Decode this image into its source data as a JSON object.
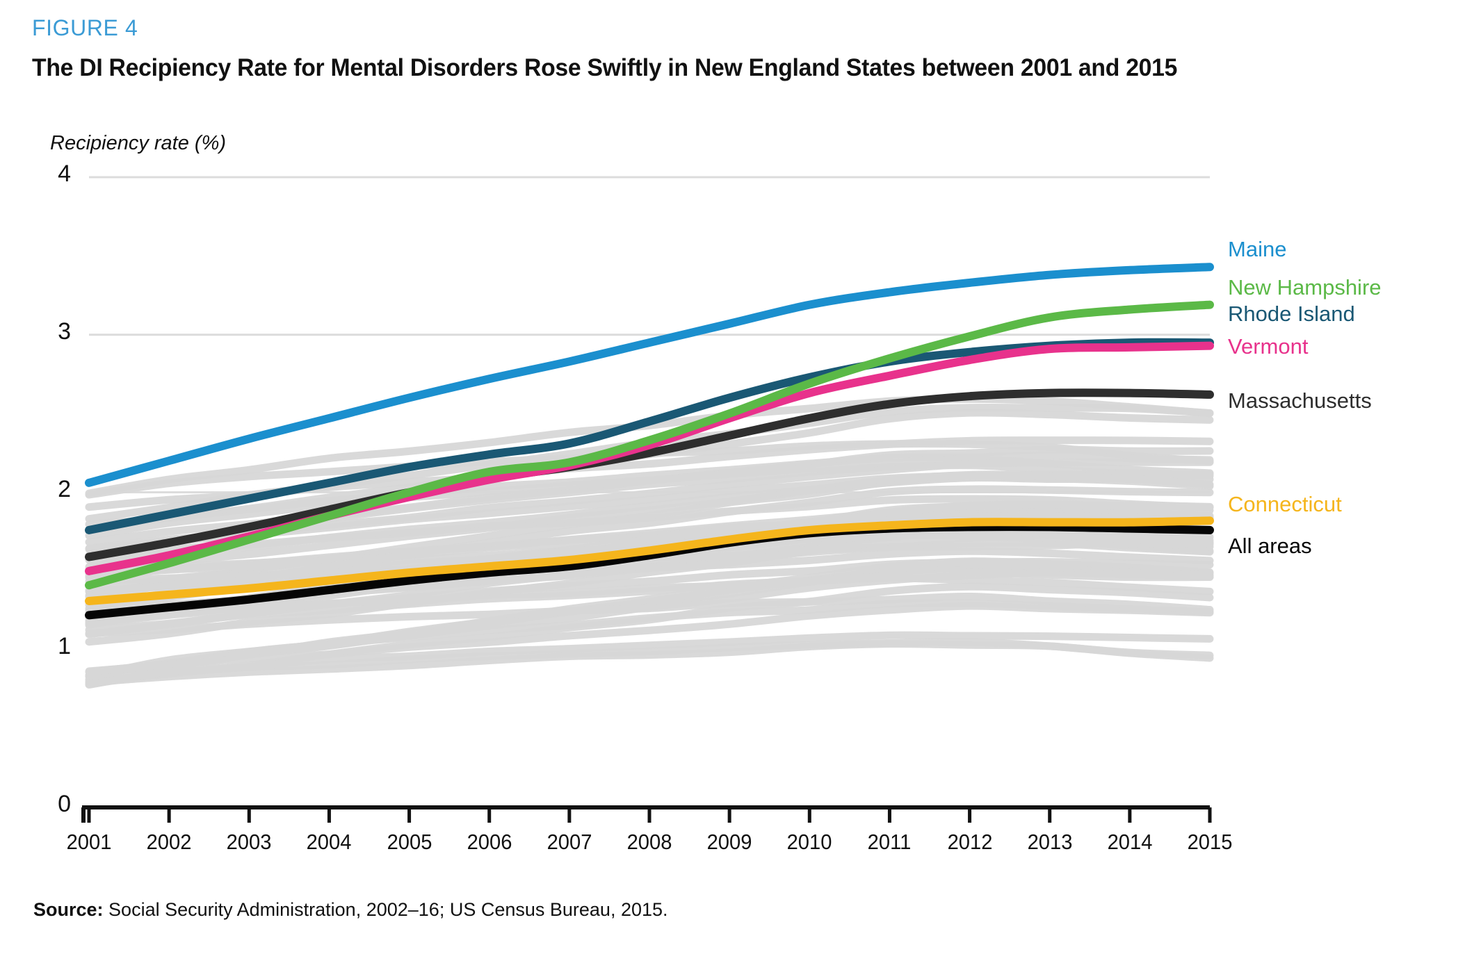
{
  "figure": {
    "number_label": "FIGURE 4",
    "number_color": "#3B9BD5",
    "title": "The DI Recipiency Rate for Mental Disorders Rose Swiftly in New England States between 2001 and 2015",
    "source": "Social Security Administration, 2002–16; US Census Bureau, 2015.",
    "source_prefix": "Source:"
  },
  "chart_data": {
    "type": "line",
    "title": "The DI Recipiency Rate for Mental Disorders Rose Swiftly in New England States between 2001 and 2015",
    "xlabel": "",
    "ylabel": "Recipiency rate (%)",
    "ylim": [
      0,
      4
    ],
    "xlim": [
      2001,
      2015
    ],
    "yticks": [
      "0",
      "1",
      "2",
      "3",
      "4"
    ],
    "ytick_values": [
      0,
      1,
      2,
      3,
      4
    ],
    "grid": "horizontal-gridlines-at-2-3-4",
    "legend_position": "right-end-of-line",
    "x": [
      2001,
      2002,
      2003,
      2004,
      2005,
      2006,
      2007,
      2008,
      2009,
      2010,
      2011,
      2012,
      2013,
      2014,
      2015
    ],
    "xtick_labels": [
      "2001",
      "2002",
      "2003",
      "2004",
      "2005",
      "2006",
      "2007",
      "2008",
      "2009",
      "2010",
      "2011",
      "2012",
      "2013",
      "2014",
      "2015"
    ],
    "series": [
      {
        "name": "Maine",
        "color": "#1B8FCE",
        "values": [
          2.06,
          2.2,
          2.34,
          2.47,
          2.6,
          2.72,
          2.83,
          2.95,
          3.07,
          3.19,
          3.27,
          3.33,
          3.38,
          3.41,
          3.43
        ]
      },
      {
        "name": "New Hampshire",
        "color": "#5BB947",
        "values": [
          1.41,
          1.55,
          1.7,
          1.85,
          2.0,
          2.13,
          2.19,
          2.33,
          2.5,
          2.69,
          2.85,
          2.99,
          3.11,
          3.16,
          3.19
        ]
      },
      {
        "name": "Rhode Island",
        "color": "#1A5874",
        "values": [
          1.76,
          1.86,
          1.96,
          2.06,
          2.16,
          2.24,
          2.31,
          2.45,
          2.6,
          2.73,
          2.83,
          2.89,
          2.93,
          2.95,
          2.95
        ]
      },
      {
        "name": "Vermont",
        "color": "#E8328C",
        "values": [
          1.5,
          1.6,
          1.72,
          1.85,
          1.97,
          2.08,
          2.17,
          2.3,
          2.47,
          2.63,
          2.74,
          2.84,
          2.91,
          2.92,
          2.93
        ]
      },
      {
        "name": "Massachusetts",
        "color": "#2E2E2E",
        "values": [
          1.59,
          1.68,
          1.78,
          1.89,
          2.0,
          2.09,
          2.16,
          2.25,
          2.36,
          2.47,
          2.56,
          2.61,
          2.63,
          2.63,
          2.62
        ]
      },
      {
        "name": "Connecticut",
        "color": "#F5B51C",
        "values": [
          1.31,
          1.35,
          1.39,
          1.44,
          1.49,
          1.53,
          1.57,
          1.63,
          1.7,
          1.76,
          1.79,
          1.81,
          1.81,
          1.81,
          1.82
        ]
      },
      {
        "name": "All areas",
        "color": "#050505",
        "values": [
          1.22,
          1.27,
          1.32,
          1.38,
          1.44,
          1.49,
          1.53,
          1.6,
          1.68,
          1.74,
          1.77,
          1.78,
          1.78,
          1.77,
          1.76
        ]
      }
    ],
    "background_series_note": "Light gray lines represent all other US states and areas",
    "background_color": "#D7D7D7"
  },
  "legend": [
    {
      "label": "Maine",
      "color": "#1B8FCE"
    },
    {
      "label": "New Hampshire",
      "color": "#5BB947"
    },
    {
      "label": "Rhode Island",
      "color": "#1A5874"
    },
    {
      "label": "Vermont",
      "color": "#E8328C"
    },
    {
      "label": "Massachusetts",
      "color": "#2E2E2E"
    },
    {
      "label": "Connecticut",
      "color": "#F5B51C"
    },
    {
      "label": "All areas",
      "color": "#050505"
    }
  ]
}
